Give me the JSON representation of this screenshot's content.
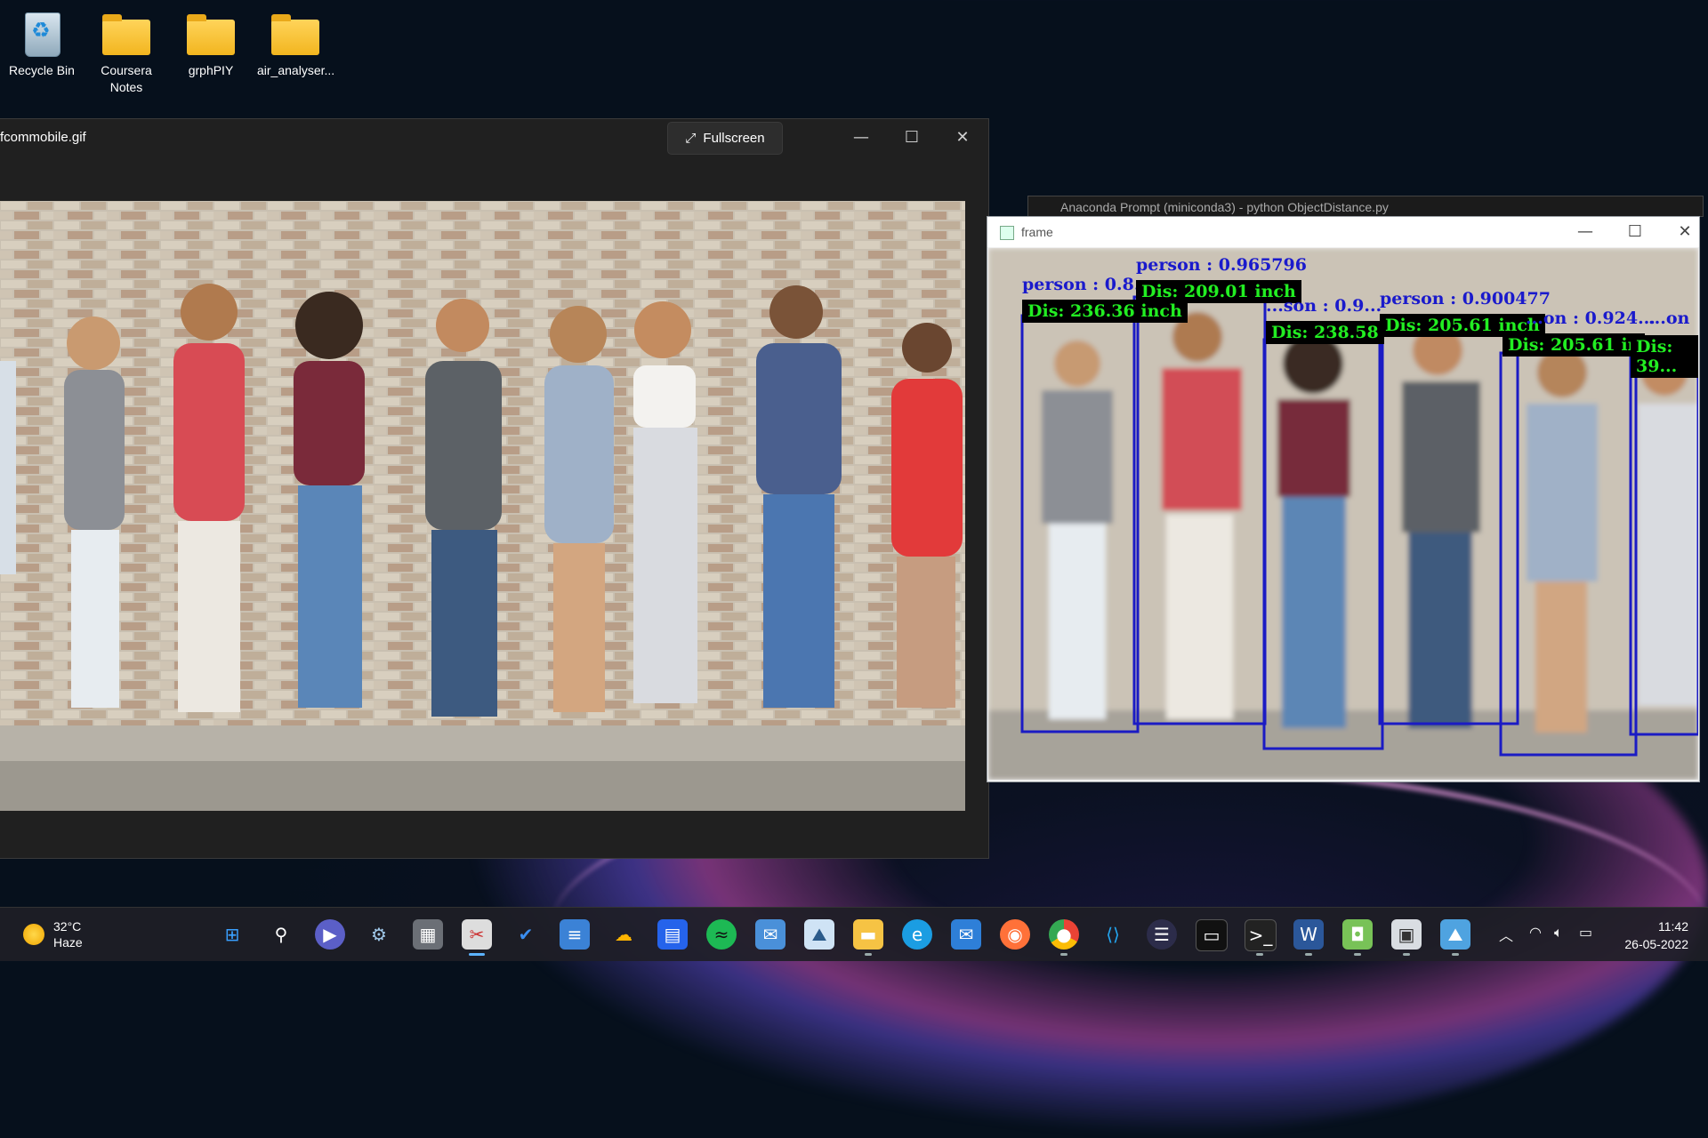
{
  "desktop": {
    "icons": [
      {
        "label": "Recycle Bin"
      },
      {
        "label": "Coursera\nNotes"
      },
      {
        "label": "grphPIY"
      },
      {
        "label": "air_analyser..."
      }
    ]
  },
  "viewer": {
    "title": "fcommobile.gif",
    "fullscreen_label": "Fullscreen",
    "minimize": "—",
    "maximize": "☐",
    "close": "✕"
  },
  "anaconda": {
    "title": "Anaconda Prompt (miniconda3) - python ObjectDistance.py"
  },
  "frame": {
    "title": "frame",
    "minimize": "—",
    "maximize": "☐",
    "close": "✕",
    "detections": [
      {
        "label": "person : 0.8...",
        "dist": "Dis: 236.36 inch"
      },
      {
        "label": "person : 0.965796",
        "dist": "Dis: 209.01 inch"
      },
      {
        "label": "...son : 0.9...",
        "dist": "Dis: 238.58"
      },
      {
        "label": "person : 0.900477",
        "dist": "Dis: 205.61 inch"
      },
      {
        "label": "...on : 0.924...",
        "dist": "Dis: 205.61 in"
      },
      {
        "label": "...on",
        "dist": "Dis: 39..."
      }
    ]
  },
  "taskbar": {
    "weather_temp": "32°C",
    "weather_desc": "Haze",
    "time": "11:42",
    "date": "26-05-2022"
  },
  "colors": {
    "bbox": "#1a1acc",
    "label_bg": "#000000",
    "label_text": "#1faa1f"
  }
}
